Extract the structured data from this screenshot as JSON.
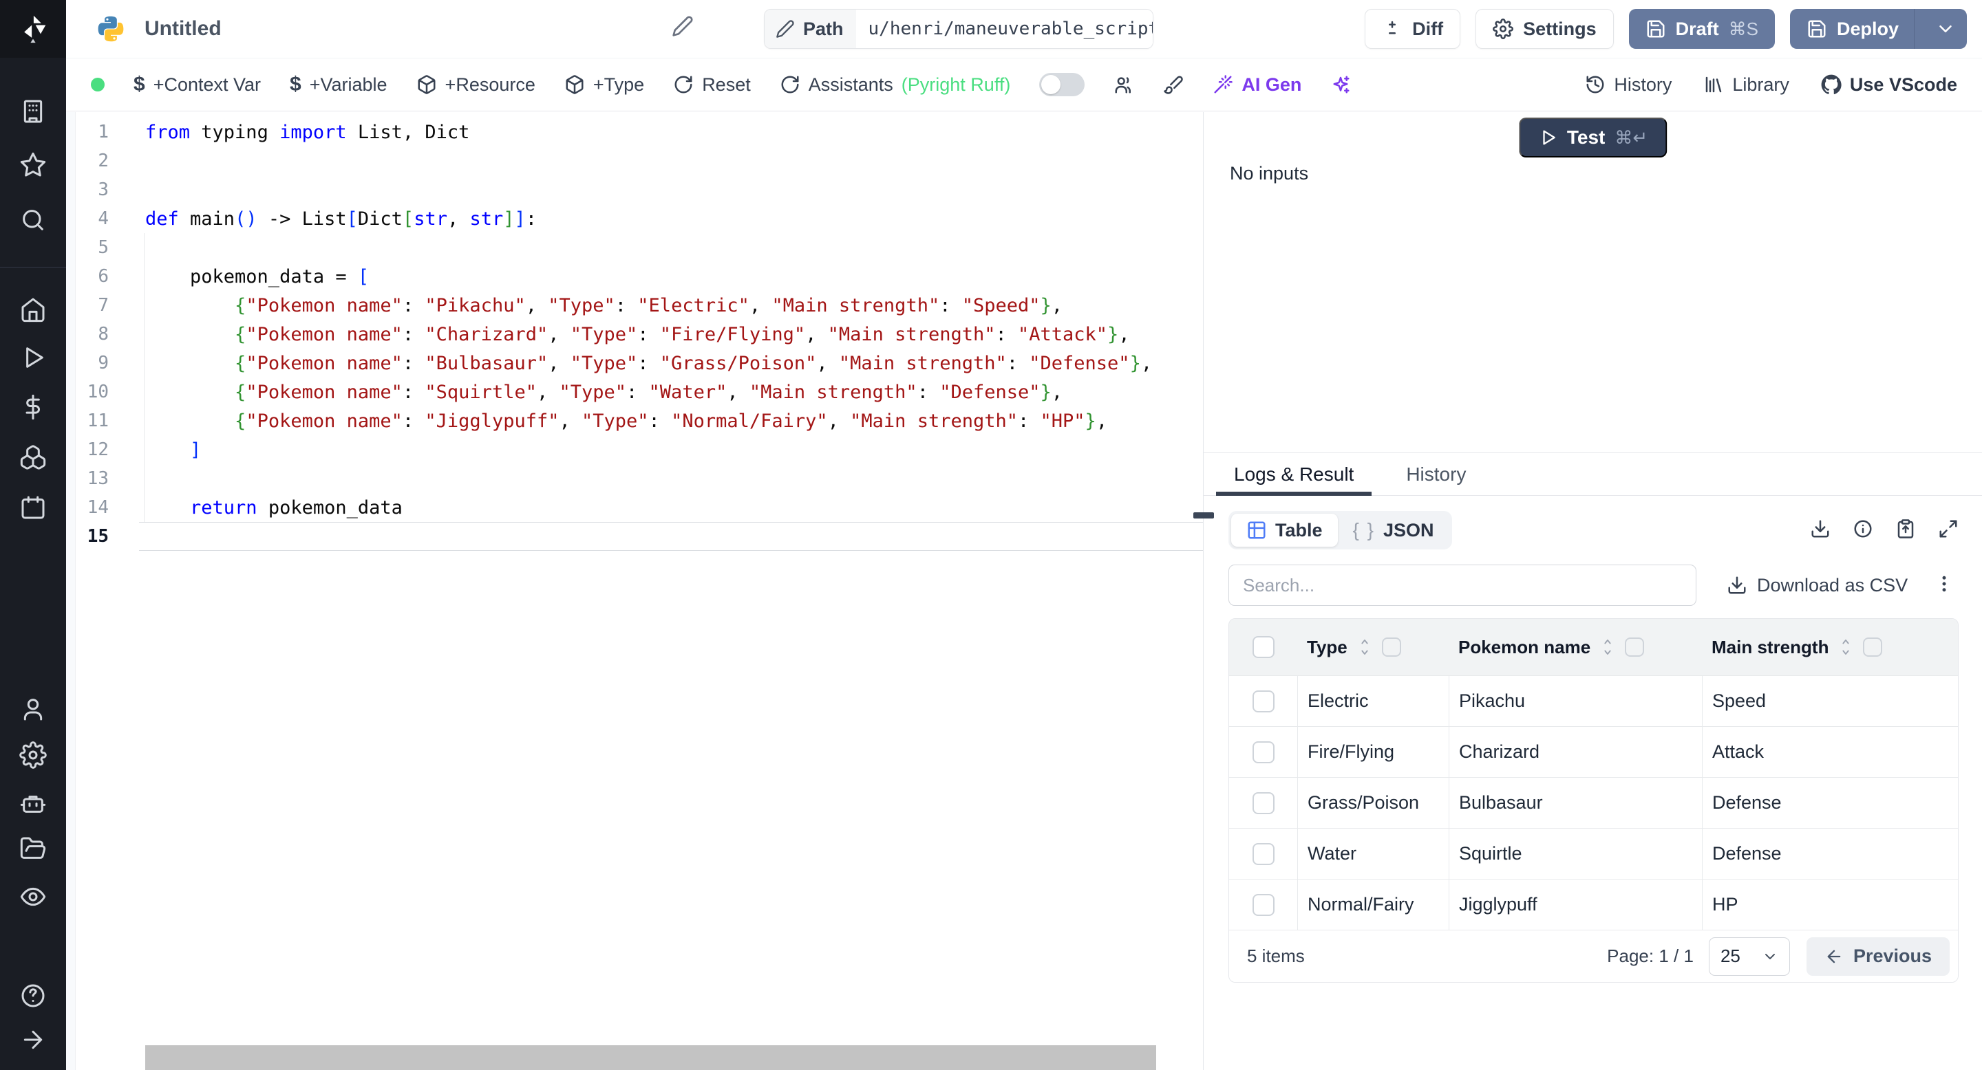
{
  "colors": {
    "accent_blue": "#4f7cf7",
    "slate_button": "#66799e",
    "test_button": "#323f58",
    "purple": "#7c3aed",
    "green": "#4ade80",
    "sidebar_bg": "#1a1d24",
    "code_keyword": "#0000ff",
    "code_string": "#a31515",
    "bracket1": "#0431fa",
    "bracket2": "#319331"
  },
  "topbar": {
    "title": "Untitled",
    "path_label": "Path",
    "path_value": "u/henri/maneuverable_script",
    "diff": "Diff",
    "settings": "Settings",
    "draft": "Draft",
    "draft_shortcut": "⌘S",
    "deploy": "Deploy"
  },
  "toolbar": {
    "add_context_var": "+Context Var",
    "add_variable": "+Variable",
    "add_resource": "+Resource",
    "add_type": "+Type",
    "reset": "Reset",
    "assistants": "Assistants",
    "assistants_detail": "(Pyright Ruff)",
    "ai_gen": "AI Gen",
    "history": "History",
    "library": "Library",
    "use_vscode": "Use VScode"
  },
  "editor": {
    "lines": [
      {
        "n": 1,
        "t": [
          [
            "kw",
            "from"
          ],
          [
            "pl",
            " typing "
          ],
          [
            "kw",
            "import"
          ],
          [
            "pl",
            " List, Dict"
          ]
        ]
      },
      {
        "n": 2,
        "t": []
      },
      {
        "n": 3,
        "t": []
      },
      {
        "n": 4,
        "t": [
          [
            "kw",
            "def"
          ],
          [
            "pl",
            " main"
          ],
          [
            "b1",
            "()"
          ],
          [
            "pl",
            " -> List"
          ],
          [
            "b1",
            "["
          ],
          [
            "pl",
            "Dict"
          ],
          [
            "b2",
            "["
          ],
          [
            "ty",
            "str"
          ],
          [
            "pl",
            ", "
          ],
          [
            "ty",
            "str"
          ],
          [
            "b2",
            "]"
          ],
          [
            "b1",
            "]"
          ],
          [
            "pl",
            ":"
          ]
        ]
      },
      {
        "n": 5,
        "t": []
      },
      {
        "n": 6,
        "t": [
          [
            "pl",
            "    pokemon_data = "
          ],
          [
            "b1",
            "["
          ]
        ]
      },
      {
        "n": 7,
        "t": [
          [
            "pl",
            "        "
          ],
          [
            "b2",
            "{"
          ],
          [
            "str",
            "\"Pokemon name\""
          ],
          [
            "pl",
            ": "
          ],
          [
            "str",
            "\"Pikachu\""
          ],
          [
            "pl",
            ", "
          ],
          [
            "str",
            "\"Type\""
          ],
          [
            "pl",
            ": "
          ],
          [
            "str",
            "\"Electric\""
          ],
          [
            "pl",
            ", "
          ],
          [
            "str",
            "\"Main strength\""
          ],
          [
            "pl",
            ": "
          ],
          [
            "str",
            "\"Speed\""
          ],
          [
            "b2",
            "}"
          ],
          [
            "pl",
            ","
          ]
        ]
      },
      {
        "n": 8,
        "t": [
          [
            "pl",
            "        "
          ],
          [
            "b2",
            "{"
          ],
          [
            "str",
            "\"Pokemon name\""
          ],
          [
            "pl",
            ": "
          ],
          [
            "str",
            "\"Charizard\""
          ],
          [
            "pl",
            ", "
          ],
          [
            "str",
            "\"Type\""
          ],
          [
            "pl",
            ": "
          ],
          [
            "str",
            "\"Fire/Flying\""
          ],
          [
            "pl",
            ", "
          ],
          [
            "str",
            "\"Main strength\""
          ],
          [
            "pl",
            ": "
          ],
          [
            "str",
            "\"Attack\""
          ],
          [
            "b2",
            "}"
          ],
          [
            "pl",
            ","
          ]
        ]
      },
      {
        "n": 9,
        "t": [
          [
            "pl",
            "        "
          ],
          [
            "b2",
            "{"
          ],
          [
            "str",
            "\"Pokemon name\""
          ],
          [
            "pl",
            ": "
          ],
          [
            "str",
            "\"Bulbasaur\""
          ],
          [
            "pl",
            ", "
          ],
          [
            "str",
            "\"Type\""
          ],
          [
            "pl",
            ": "
          ],
          [
            "str",
            "\"Grass/Poison\""
          ],
          [
            "pl",
            ", "
          ],
          [
            "str",
            "\"Main strength\""
          ],
          [
            "pl",
            ": "
          ],
          [
            "str",
            "\"Defense\""
          ],
          [
            "b2",
            "}"
          ],
          [
            "pl",
            ","
          ]
        ]
      },
      {
        "n": 10,
        "t": [
          [
            "pl",
            "        "
          ],
          [
            "b2",
            "{"
          ],
          [
            "str",
            "\"Pokemon name\""
          ],
          [
            "pl",
            ": "
          ],
          [
            "str",
            "\"Squirtle\""
          ],
          [
            "pl",
            ", "
          ],
          [
            "str",
            "\"Type\""
          ],
          [
            "pl",
            ": "
          ],
          [
            "str",
            "\"Water\""
          ],
          [
            "pl",
            ", "
          ],
          [
            "str",
            "\"Main strength\""
          ],
          [
            "pl",
            ": "
          ],
          [
            "str",
            "\"Defense\""
          ],
          [
            "b2",
            "}"
          ],
          [
            "pl",
            ","
          ]
        ]
      },
      {
        "n": 11,
        "t": [
          [
            "pl",
            "        "
          ],
          [
            "b2",
            "{"
          ],
          [
            "str",
            "\"Pokemon name\""
          ],
          [
            "pl",
            ": "
          ],
          [
            "str",
            "\"Jigglypuff\""
          ],
          [
            "pl",
            ", "
          ],
          [
            "str",
            "\"Type\""
          ],
          [
            "pl",
            ": "
          ],
          [
            "str",
            "\"Normal/Fairy\""
          ],
          [
            "pl",
            ", "
          ],
          [
            "str",
            "\"Main strength\""
          ],
          [
            "pl",
            ": "
          ],
          [
            "str",
            "\"HP\""
          ],
          [
            "b2",
            "}"
          ],
          [
            "pl",
            ","
          ]
        ]
      },
      {
        "n": 12,
        "t": [
          [
            "pl",
            "    "
          ],
          [
            "b1",
            "]"
          ]
        ]
      },
      {
        "n": 13,
        "t": []
      },
      {
        "n": 14,
        "t": [
          [
            "pl",
            "    "
          ],
          [
            "kw",
            "return"
          ],
          [
            "pl",
            " pokemon_data"
          ]
        ]
      },
      {
        "n": 15,
        "t": []
      }
    ],
    "current_line": 15
  },
  "run": {
    "test_label": "Test",
    "test_shortcut": "⌘↵",
    "no_inputs": "No inputs"
  },
  "result_panel": {
    "tabs": [
      {
        "label": "Logs & Result"
      },
      {
        "label": "History"
      }
    ],
    "view_toggle": [
      {
        "label": "Table"
      },
      {
        "label": "JSON"
      }
    ],
    "braces_icon": "{ }",
    "search_placeholder": "Search...",
    "download_csv": "Download as CSV",
    "table": {
      "columns": [
        "Type",
        "Pokemon name",
        "Main strength"
      ],
      "rows": [
        [
          "Electric",
          "Pikachu",
          "Speed"
        ],
        [
          "Fire/Flying",
          "Charizard",
          "Attack"
        ],
        [
          "Grass/Poison",
          "Bulbasaur",
          "Defense"
        ],
        [
          "Water",
          "Squirtle",
          "Defense"
        ],
        [
          "Normal/Fairy",
          "Jigglypuff",
          "HP"
        ]
      ]
    },
    "footer": {
      "items_count": "5 items",
      "page": "Page: 1 / 1",
      "page_size": "25",
      "previous": "Previous"
    }
  },
  "sidebar_icons": [
    "windmill-logo",
    "building",
    "star",
    "search",
    "home",
    "play",
    "dollar",
    "boxes",
    "calendar",
    "user",
    "gear",
    "bot",
    "folder-open",
    "eye",
    "help-circle",
    "arrow-right"
  ]
}
